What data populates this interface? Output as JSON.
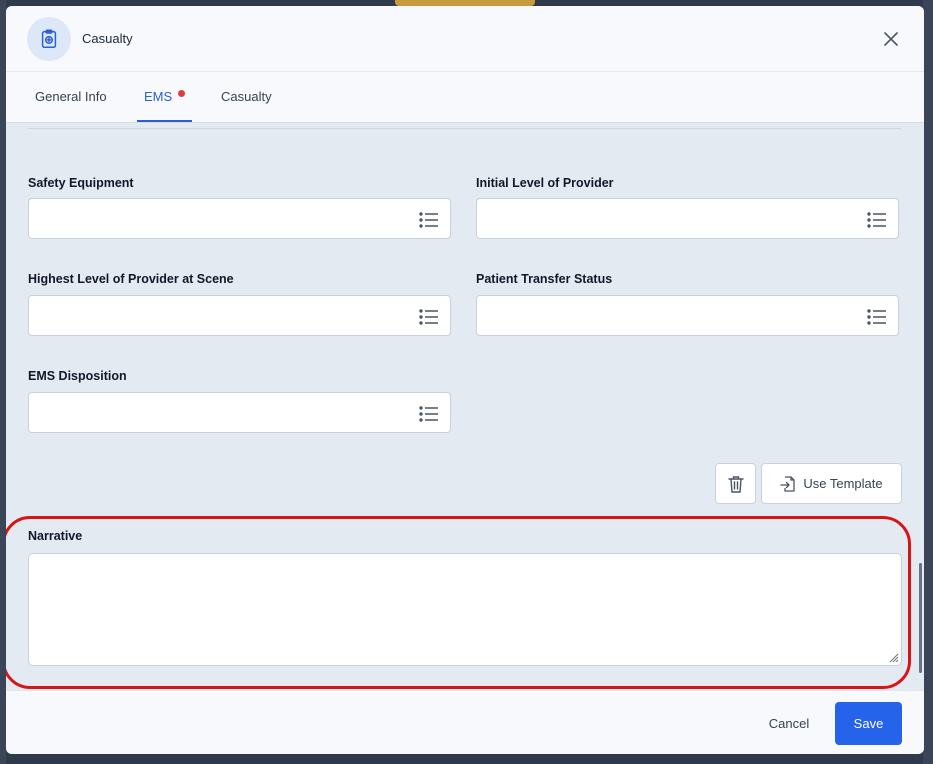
{
  "modal": {
    "title": "Casualty",
    "header_icon": "clipboard-medical-icon",
    "close_icon": "close-icon"
  },
  "tabs": [
    {
      "label": "General Info",
      "active": false
    },
    {
      "label": "EMS",
      "active": true,
      "has_indicator": true
    },
    {
      "label": "Casualty",
      "active": false
    }
  ],
  "form": {
    "fields": [
      {
        "label": "Safety Equipment",
        "value": ""
      },
      {
        "label": "Initial Level of Provider",
        "value": ""
      },
      {
        "label": "Highest Level of Provider at Scene",
        "value": ""
      },
      {
        "label": "Patient Transfer Status",
        "value": ""
      },
      {
        "label": "EMS Disposition",
        "value": ""
      }
    ],
    "field_icon": "list-icon"
  },
  "actions": {
    "delete_icon": "trash-icon",
    "use_template_label": "Use Template",
    "use_template_icon": "file-import-icon"
  },
  "narrative": {
    "label": "Narrative",
    "value": ""
  },
  "footer": {
    "cancel_label": "Cancel",
    "save_label": "Save"
  },
  "colors": {
    "accent": "#2563eb",
    "highlight": "#d81414",
    "tab_indicator": "#e23b3b"
  }
}
